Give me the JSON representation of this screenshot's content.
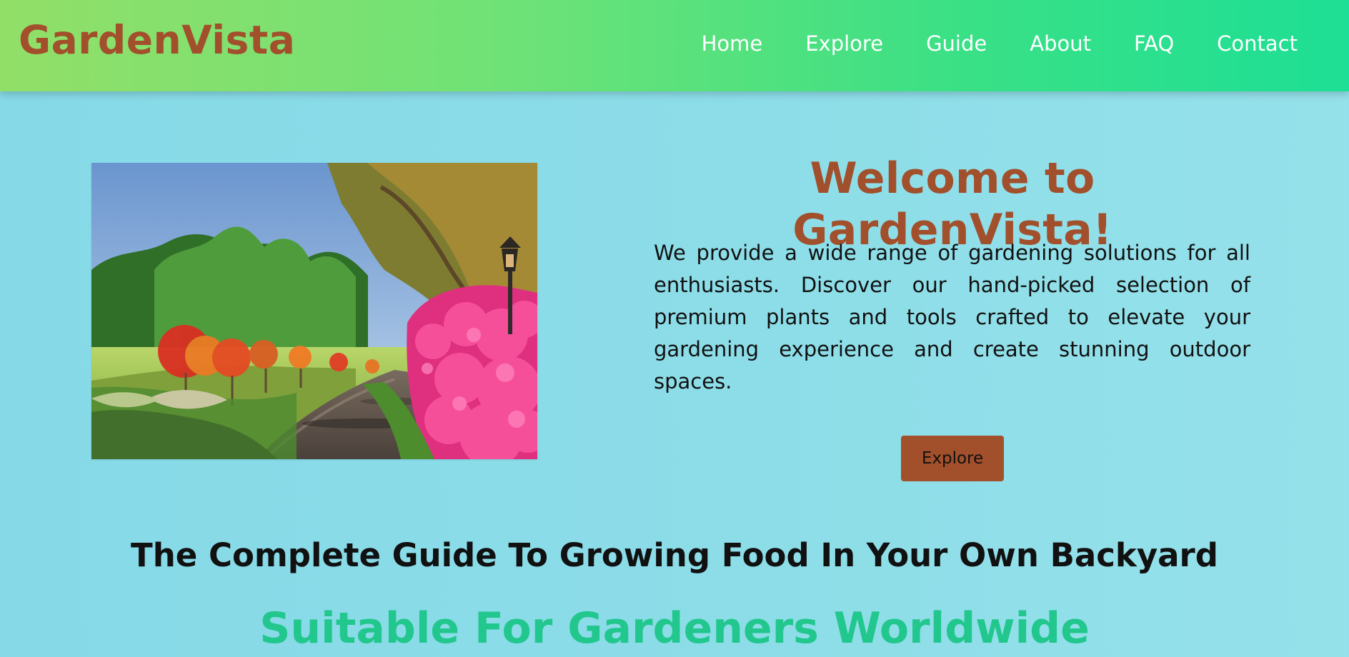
{
  "brand": {
    "logo": "GardenVista"
  },
  "nav": {
    "items": [
      {
        "label": "Home"
      },
      {
        "label": "Explore"
      },
      {
        "label": "Guide"
      },
      {
        "label": "About"
      },
      {
        "label": "FAQ"
      },
      {
        "label": "Contact"
      }
    ]
  },
  "hero": {
    "image_name": "garden-path-photo",
    "title": "Welcome to GardenVista!",
    "description": "We provide a wide range of gardening solutions for all enthusiasts. Discover our hand-picked selection of premium plants and tools crafted to elevate your gardening experience and create stunning outdoor spaces.",
    "button_label": "Explore"
  },
  "guide": {
    "title": "The Complete Guide To Growing Food In Your Own Backyard",
    "subtitle": "Suitable For Gardeners Worldwide"
  },
  "colors": {
    "brand": "#a24f2c",
    "subtitle": "#22c78d",
    "nav_gradient_start": "#92df68",
    "nav_gradient_end": "#1ddf95",
    "page_background": "#8cdde8"
  },
  "icons": {
    "hero_image": "garden-path-photo"
  }
}
